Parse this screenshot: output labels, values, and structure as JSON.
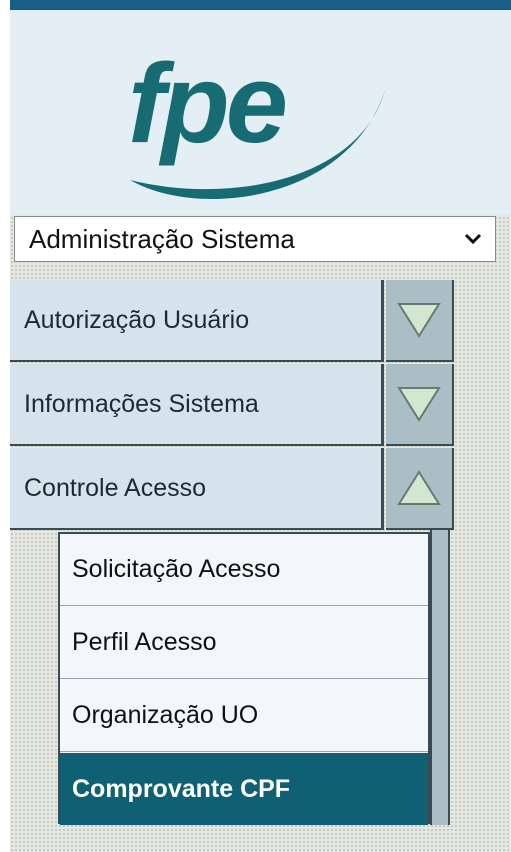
{
  "logo": {
    "text": "fpe",
    "color": "#176b72"
  },
  "system_select": {
    "selected": "Administração Sistema",
    "icon": "chevron-down-icon"
  },
  "menu": [
    {
      "label": "Autorização Usuário",
      "icon": "triangle-down-icon",
      "expanded": false
    },
    {
      "label": "Informações Sistema",
      "icon": "triangle-down-icon",
      "expanded": false
    },
    {
      "label": "Controle Acesso",
      "icon": "triangle-up-icon",
      "expanded": true
    }
  ],
  "submenu": [
    {
      "label": "Solicitação Acesso",
      "active": false
    },
    {
      "label": "Perfil Acesso",
      "active": false
    },
    {
      "label": "Organização UO",
      "active": false
    },
    {
      "label": "Comprovante CPF",
      "active": true
    }
  ],
  "colors": {
    "top_bar": "#175f87",
    "active_item": "#0f6072",
    "arrow_fill": "#d3e6cf"
  }
}
